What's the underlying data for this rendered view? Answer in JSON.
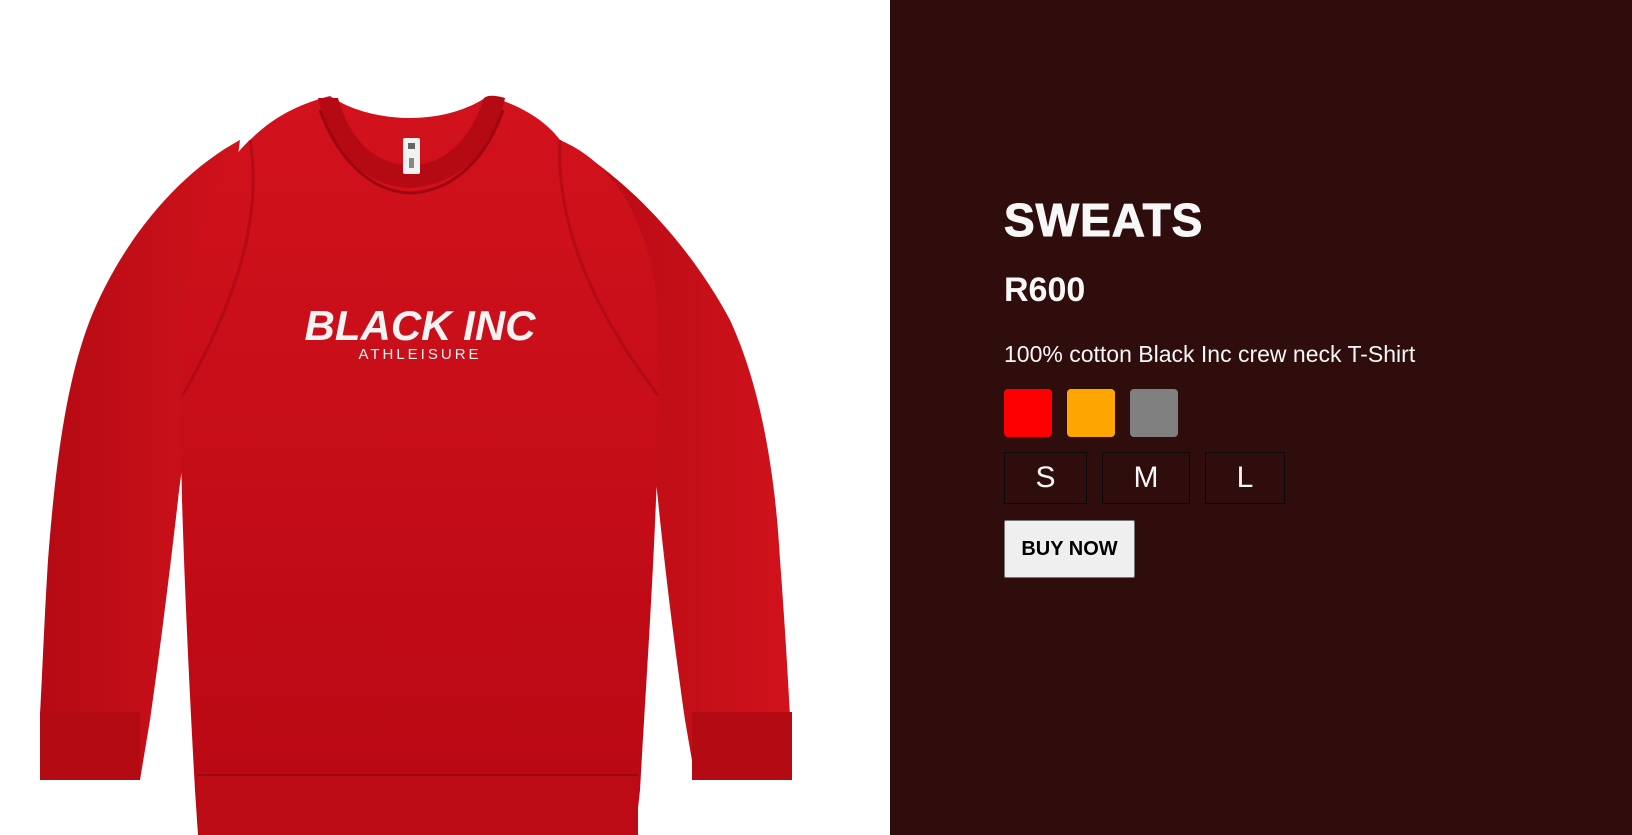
{
  "product": {
    "image_alt": "Red Black Inc Athleisure crew neck sweatshirt",
    "image_logo_line1": "BLACK INC",
    "image_logo_line2": "ATHLEISURE",
    "title": "SWEATS",
    "price": "R600",
    "description": "100% cotton Black Inc crew neck T-Shirt"
  },
  "colors": {
    "panel_background": "#2f0d0d",
    "garment": "#c8101a",
    "swatches": [
      "#ff0000",
      "#ffa500",
      "#808080"
    ]
  },
  "color_options": [
    {
      "name": "red",
      "hex": "#ff0000"
    },
    {
      "name": "orange",
      "hex": "#ffa500"
    },
    {
      "name": "grey",
      "hex": "#808080"
    }
  ],
  "sizes": [
    {
      "label": "S"
    },
    {
      "label": "M"
    },
    {
      "label": "L"
    }
  ],
  "actions": {
    "buy_label": "BUY NOW"
  }
}
